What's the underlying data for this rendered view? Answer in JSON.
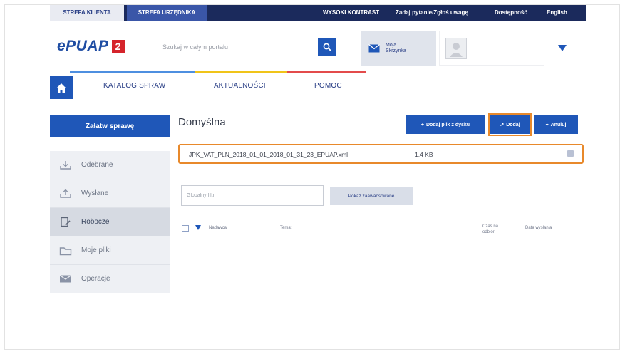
{
  "topbar": {
    "tab_client": "STREFA KLIENTA",
    "tab_official": "STREFA URZĘDNIKA",
    "links": [
      "WYSOKI KONTRAST",
      "Zadaj pytanie/Zgłoś uwagę",
      "Dostępność",
      "English"
    ]
  },
  "header": {
    "logo_text": "ePUAP",
    "logo_badge": "2",
    "search_placeholder": "Szukaj w całym portalu",
    "inbox_label": "Moja Skrzynka"
  },
  "nav": {
    "items": [
      "KATALOG SPRAW",
      "AKTUALNOŚCI",
      "POMOC"
    ],
    "line_colors": [
      "#4e8fe0",
      "#f0c419",
      "#e34b4b"
    ]
  },
  "sidebar": {
    "action_label": "Załatw sprawę",
    "items": [
      {
        "label": "Odebrane",
        "icon": "inbox-download-icon"
      },
      {
        "label": "Wysłane",
        "icon": "outbox-upload-icon"
      },
      {
        "label": "Robocze",
        "icon": "draft-edit-icon"
      },
      {
        "label": "Moje pliki",
        "icon": "folder-icon"
      },
      {
        "label": "Operacje",
        "icon": "envelope-icon"
      }
    ]
  },
  "main": {
    "title": "Domyślna",
    "buttons": {
      "add_from_disk": "Dodaj plik z dysku",
      "add": "Dodaj",
      "cancel": "Anuluj"
    },
    "file": {
      "name": "JPK_VAT_PLN_2018_01_01_2018_01_31_23_EPUAP.xml",
      "size": "1.4 KB"
    },
    "filter_placeholder": "Globalny filtr",
    "advanced_button": "Pokaż zaawansowane",
    "columns": [
      "Nadawca",
      "Temat",
      "Czas na odbiór",
      "Data wysłania"
    ]
  },
  "colors": {
    "primary": "#1f57b8",
    "navy": "#1b2a5c",
    "highlight": "#e8892b"
  }
}
